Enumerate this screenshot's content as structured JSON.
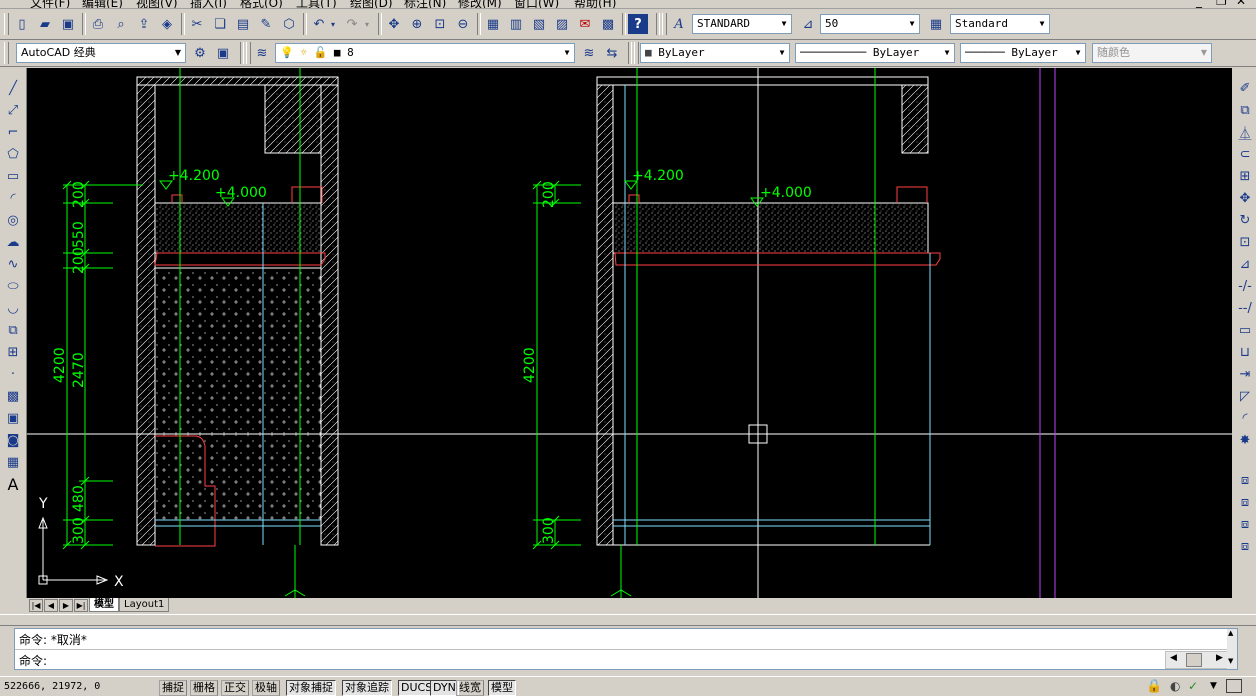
{
  "menu": [
    "文件(F)",
    "编辑(E)",
    "视图(V)",
    "插入(I)",
    "格式(O)",
    "工具(T)",
    "绘图(D)",
    "标注(N)",
    "修改(M)",
    "窗口(W)",
    "帮助(H)"
  ],
  "styles": {
    "text_style": "STANDARD",
    "dim_style": "50",
    "table_style": "Standard"
  },
  "workspace": "AutoCAD 经典",
  "layer": {
    "current": "8",
    "color_combo": "ByLayer",
    "linetype_combo": "ByLayer",
    "lineweight_combo": "ByLayer",
    "plot_style_combo": "随颜色"
  },
  "drawing": {
    "left": {
      "level_top": "+4.200",
      "level_bottom": "+4.000",
      "dims": [
        "200",
        "550",
        "200",
        "2470",
        "480",
        "300"
      ],
      "overall": "4200"
    },
    "right": {
      "level_top": "+4.200",
      "level_bottom": "+4.000",
      "dims": [
        "200",
        "300"
      ],
      "overall": "4200"
    },
    "ucs": {
      "x_label": "X",
      "y_label": "Y"
    }
  },
  "tabs": {
    "model": "模型",
    "layout1": "Layout1"
  },
  "command": {
    "history": "命令: *取消*",
    "prompt": "命令:"
  },
  "status": {
    "coords": "522666, 21972, 0",
    "toggles": [
      {
        "label": "捕捉",
        "on": false
      },
      {
        "label": "栅格",
        "on": false
      },
      {
        "label": "正交",
        "on": false
      },
      {
        "label": "极轴",
        "on": false
      },
      {
        "label": "对象捕捉",
        "on": true
      },
      {
        "label": "对象追踪",
        "on": true
      },
      {
        "label": "DUCS",
        "on": true
      },
      {
        "label": "DYN",
        "on": true
      },
      {
        "label": "线宽",
        "on": false
      },
      {
        "label": "模型",
        "on": true
      }
    ]
  },
  "colors": {
    "canvas": "#000000",
    "green_dim": "#00ff00",
    "red_trim": "#ff4040",
    "cyan_line": "#80e0ff",
    "magenta_line": "#c040ff",
    "wall_white": "#ffffff"
  }
}
